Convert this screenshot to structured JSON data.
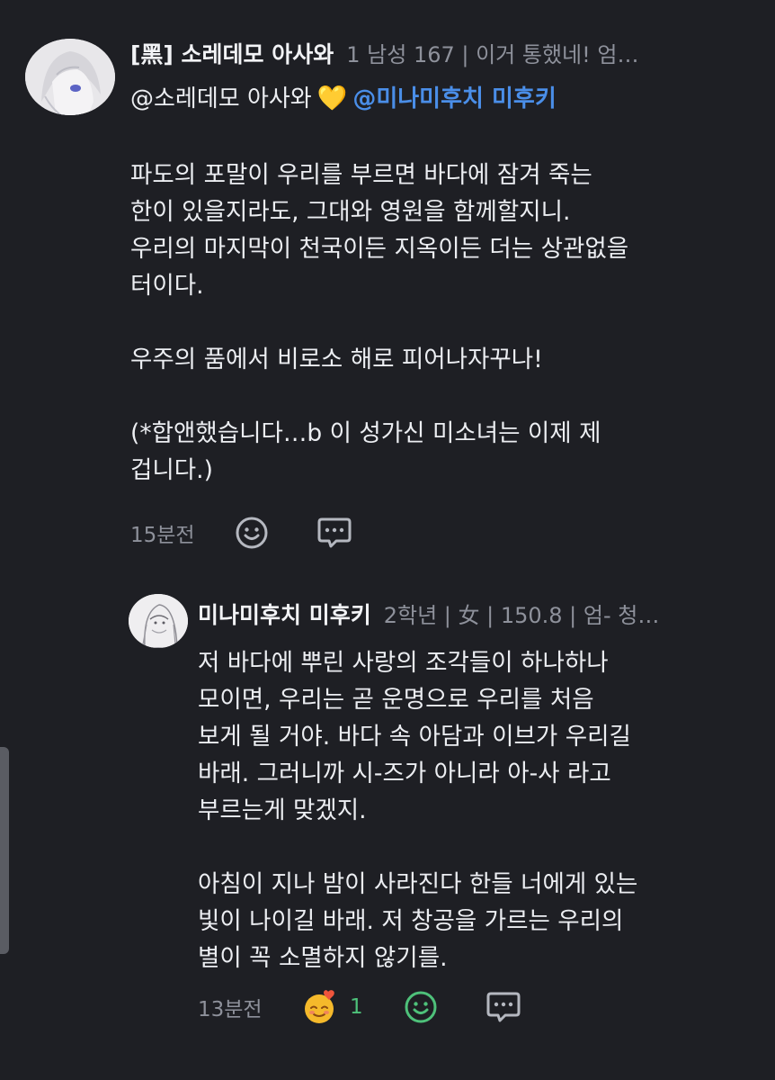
{
  "comments": [
    {
      "author": "[黑] 소레데모 아사와",
      "meta": "1 남성 167 | 이거 통했네! 엄…",
      "mention": {
        "user": "@소레데모 아사와",
        "heart": "💛",
        "link": "@미나미후치 미후키"
      },
      "body": "파도의 포말이 우리를 부르면 바다에 잠겨 죽는\n한이 있을지라도, 그대와 영원을 함께할지니.\n우리의 마지막이 천국이든 지옥이든 더는 상관없을\n터이다.\n\n우주의 품에서 비로소 해로 피어나자꾸나!\n\n(*합앤했습니다…b 이 성가신 미소녀는 이제 제\n겁니다.)",
      "time": "15분전",
      "icons": [
        "emoji-reaction-icon",
        "reply-icon"
      ]
    },
    {
      "author": "미나미후치 미후키",
      "meta": "2학년 | 女 | 150.8 | 엄- 청…",
      "body": "저 바다에 뿌린 사랑의 조각들이 하나하나\n모이면, 우리는 곧 운명으로 우리를 처음\n보게 될 거야. 바다 속 아담과 이브가 우리길\n바래. 그러니까 시-즈가 아니라 아-사 라고\n부르는게 맞겠지.\n\n아침이 지나 밤이 사라진다 한들 너에게 있는\n빛이 나이길 바래. 저 창공을 가르는 우리의\n별이 꼭 소멸하지 않기를.",
      "time": "13분전",
      "reaction": {
        "emoji": "love-face-emoji",
        "count": "1"
      },
      "icons": [
        "emoji-reaction-icon-active",
        "reply-icon"
      ]
    }
  ],
  "colors": {
    "background": "#1e1f24",
    "mention": "#4a8ee8",
    "active": "#4ec17a",
    "muted": "#8e919b"
  }
}
